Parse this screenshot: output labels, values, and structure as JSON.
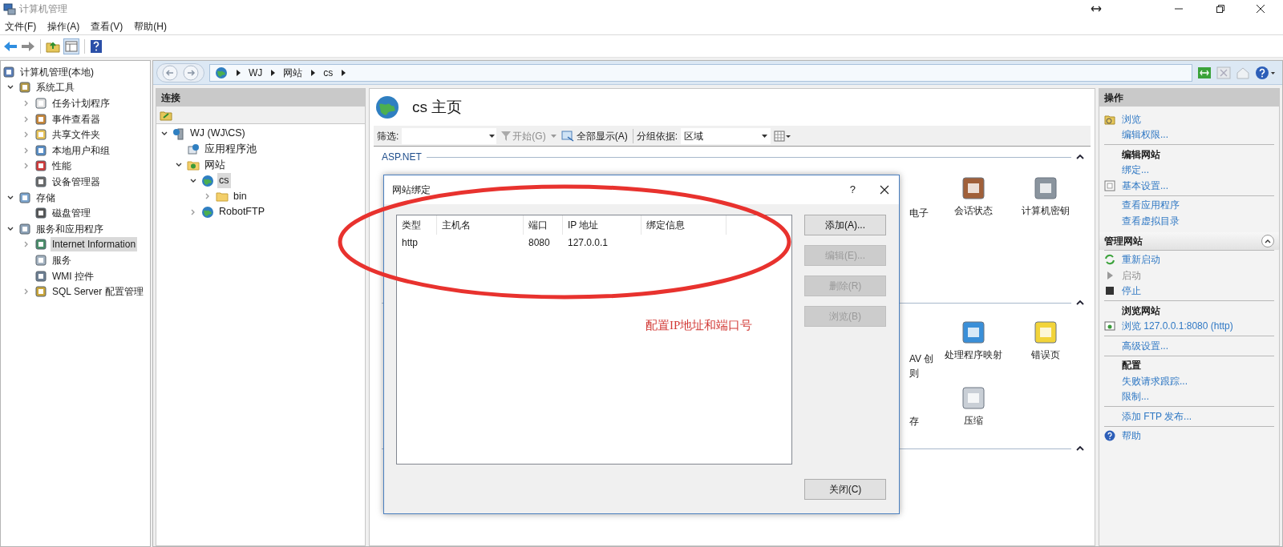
{
  "window": {
    "title": "计算机管理"
  },
  "menu": [
    "文件(F)",
    "操作(A)",
    "查看(V)",
    "帮助(H)"
  ],
  "nav_tree": [
    {
      "label": "计算机管理(本地)",
      "children": [
        {
          "label": "系统工具",
          "expanded": true,
          "children": [
            {
              "label": "任务计划程序",
              "expanded": false
            },
            {
              "label": "事件查看器",
              "expanded": false
            },
            {
              "label": "共享文件夹",
              "expanded": false
            },
            {
              "label": "本地用户和组",
              "expanded": false
            },
            {
              "label": "性能",
              "expanded": false
            },
            {
              "label": "设备管理器"
            }
          ]
        },
        {
          "label": "存储",
          "expanded": true,
          "children": [
            {
              "label": "磁盘管理"
            }
          ]
        },
        {
          "label": "服务和应用程序",
          "expanded": true,
          "children": [
            {
              "label": "Internet Information",
              "expanded": false,
              "selected": true
            },
            {
              "label": "服务"
            },
            {
              "label": "WMI 控件"
            },
            {
              "label": "SQL Server 配置管理",
              "expanded": false
            }
          ]
        }
      ]
    }
  ],
  "address_bar": {
    "breadcrumb": [
      "WJ",
      "网站",
      "cs"
    ]
  },
  "connections": {
    "title": "连接",
    "tree": [
      {
        "label": "WJ (WJ\\CS)",
        "expanded": true,
        "children": [
          {
            "label": "应用程序池"
          },
          {
            "label": "网站",
            "expanded": true,
            "children": [
              {
                "label": "cs",
                "expanded": true,
                "selected": true,
                "children": [
                  {
                    "label": "bin",
                    "expanded": false
                  }
                ]
              },
              {
                "label": "RobotFTP",
                "expanded": false
              }
            ]
          }
        ]
      }
    ]
  },
  "home": {
    "title": "cs 主页",
    "filter": {
      "label": "筛选:",
      "start": "开始(G)",
      "show_all": "全部显示(A)",
      "group_by_label": "分组依据:",
      "group_by": "区域"
    },
    "groups": [
      {
        "title": "ASP.NET",
        "expanded": true,
        "features": [
          {
            "label": "电子"
          },
          {
            "label": "会话状态"
          },
          {
            "label": "计算机密钥"
          }
        ]
      },
      {
        "expanded": true,
        "features": [
          {
            "label": "AV 创"
          },
          {
            "label": "处理程序映射"
          },
          {
            "label": "错误页"
          },
          {
            "label": "存"
          },
          {
            "label": "压缩"
          }
        ],
        "fragment": "则"
      },
      {
        "expanded": true
      }
    ]
  },
  "actions": {
    "title": "操作",
    "groups": [
      {
        "sections": [
          {
            "items": [
              {
                "label": "浏览",
                "disabled": false
              },
              {
                "label": "编辑权限...",
                "disabled": false
              }
            ]
          },
          {
            "title": "编辑网站",
            "items": [
              {
                "label": "绑定...",
                "disabled": false
              },
              {
                "label": "基本设置...",
                "disabled": false
              }
            ]
          },
          {
            "items": [
              {
                "label": "查看应用程序",
                "disabled": false
              },
              {
                "label": "查看虚拟目录",
                "disabled": false
              }
            ]
          }
        ]
      },
      {
        "title": "管理网站",
        "expanded": true,
        "sections": [
          {
            "items": [
              {
                "label": "重新启动",
                "disabled": false
              },
              {
                "label": "启动",
                "disabled": true
              },
              {
                "label": "停止",
                "disabled": false
              }
            ]
          },
          {
            "title": "浏览网站",
            "items": [
              {
                "label": "浏览 127.0.0.1:8080 (http)",
                "disabled": false
              }
            ]
          },
          {
            "items": [
              {
                "label": "高级设置...",
                "disabled": false
              }
            ]
          },
          {
            "title": "配置",
            "items": [
              {
                "label": "失败请求跟踪...",
                "disabled": false
              },
              {
                "label": "限制...",
                "disabled": false
              }
            ]
          },
          {
            "items": [
              {
                "label": "添加 FTP 发布...",
                "disabled": false
              }
            ]
          },
          {
            "items": [
              {
                "label": "帮助",
                "disabled": false
              }
            ]
          }
        ]
      }
    ]
  },
  "dialog": {
    "title": "网站绑定",
    "help": "?",
    "columns": [
      "类型",
      "主机名",
      "端口",
      "IP 地址",
      "绑定信息"
    ],
    "rows": [
      {
        "type": "http",
        "port": "8080",
        "ip_address": "127.0.0.1"
      }
    ],
    "buttons": [
      {
        "label": "添加(A)...",
        "disabled": false
      },
      {
        "label": "编辑(E)...",
        "disabled": true
      },
      {
        "label": "删除(R)",
        "disabled": true
      },
      {
        "label": "浏览(B)",
        "disabled": true
      }
    ],
    "close_button": "关闭(C)"
  },
  "annotation": {
    "note": "配置IP地址和端口号"
  }
}
